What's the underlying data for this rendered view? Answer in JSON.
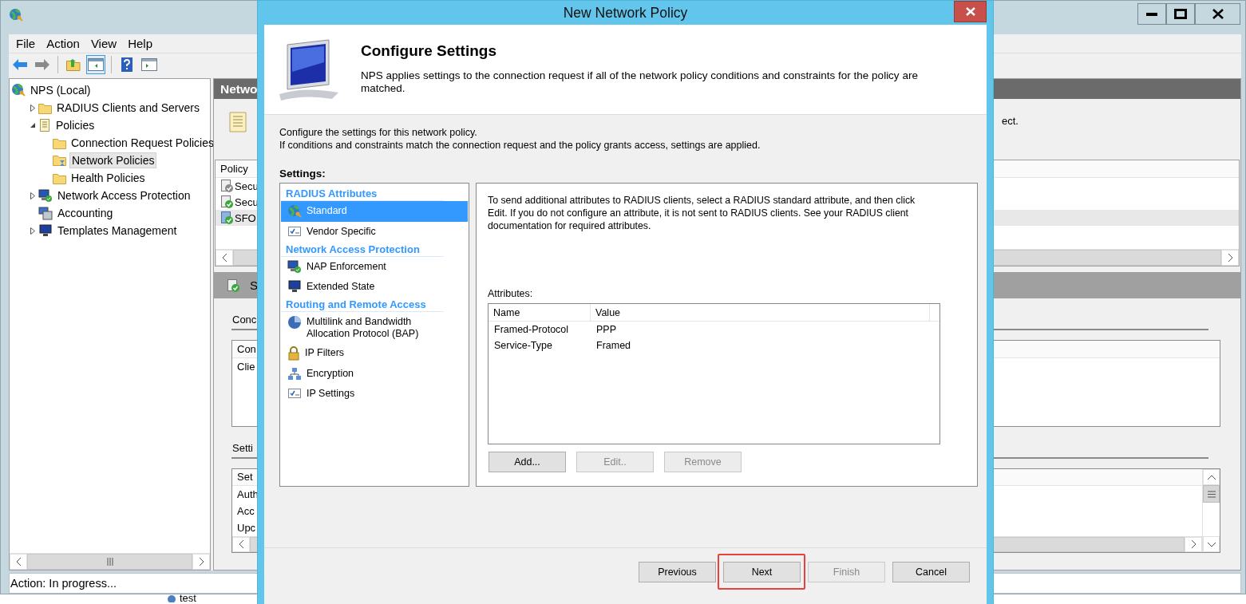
{
  "console": {
    "menu": [
      "File",
      "Action",
      "View",
      "Help"
    ],
    "toolbar": [
      {
        "disabled": false,
        "pressed": false
      },
      {
        "disabled": true,
        "pressed": false
      },
      {
        "disabled": false,
        "pressed": false
      },
      {
        "disabled": false,
        "pressed": true
      },
      {
        "disabled": false,
        "pressed": false
      },
      {
        "disabled": false,
        "pressed": false
      }
    ],
    "tree": [
      {
        "label": "NPS (Local)",
        "selected": false,
        "children": [
          {
            "label": "RADIUS Clients and Servers",
            "selected": false,
            "expanded": false
          },
          {
            "label": "Policies",
            "selected": false,
            "expanded": true,
            "children": [
              {
                "label": "Connection Request Policies",
                "selected": false
              },
              {
                "label": "Network Policies",
                "selected": true
              },
              {
                "label": "Health Policies",
                "selected": false
              }
            ]
          },
          {
            "label": "Network Access Protection",
            "selected": false,
            "expanded": false
          },
          {
            "label": "Accounting",
            "selected": false
          },
          {
            "label": "Templates Management",
            "selected": false,
            "expanded": false
          }
        ]
      }
    ],
    "details": {
      "title": "Netwo",
      "note": "ect.",
      "policies": {
        "column_1": "Policy",
        "rows": [
          {
            "name": "Secu",
            "selected": false
          },
          {
            "name": "Secu",
            "selected": false
          },
          {
            "name": "SFO",
            "selected": true
          }
        ]
      },
      "policy_bar": "S",
      "conditions": {
        "heading": "Conc",
        "column_1": "Con",
        "rows": [
          "Clie"
        ]
      },
      "settings": {
        "heading": "Setti",
        "column_1": "Set",
        "rows": [
          "Auth",
          "Acc",
          "Upc"
        ]
      }
    },
    "status_bar": "Action:  In progress..."
  },
  "desktop_item": "test",
  "dialog": {
    "title": "New Network Policy",
    "heading": "Configure Settings",
    "description": "NPS applies settings to the connection request if all of the network policy conditions and constraints for the policy are matched.",
    "intro": [
      "Configure the settings for this network policy.",
      "If conditions and constraints match the connection request and the policy grants access, settings are applied."
    ],
    "settings_label": "Settings:",
    "groups": [
      {
        "title": "RADIUS Attributes",
        "items": [
          {
            "label": "Standard",
            "selected": true
          },
          {
            "label": "Vendor Specific",
            "selected": false
          }
        ]
      },
      {
        "title": "Network Access Protection",
        "items": [
          {
            "label": "NAP Enforcement",
            "selected": false
          },
          {
            "label": "Extended State",
            "selected": false
          }
        ]
      },
      {
        "title": "Routing and Remote Access",
        "items": [
          {
            "label": "Multilink and Bandwidth Allocation Protocol (BAP)",
            "selected": false
          },
          {
            "label": "IP Filters",
            "selected": false
          },
          {
            "label": "Encryption",
            "selected": false
          },
          {
            "label": "IP Settings",
            "selected": false
          }
        ]
      }
    ],
    "panel_text": "To send additional attributes to RADIUS clients, select a RADIUS standard attribute, and then click Edit. If you do not configure an attribute, it is not sent to RADIUS clients. See your RADIUS client documentation for required attributes.",
    "attributes_label": "Attributes:",
    "attributes": {
      "columns": [
        "Name",
        "Value"
      ],
      "rows": [
        [
          "Framed-Protocol",
          "PPP"
        ],
        [
          "Service-Type",
          "Framed"
        ]
      ]
    },
    "attribute_buttons": [
      {
        "label": "Add...",
        "disabled": false
      },
      {
        "label": "Edit..",
        "disabled": true
      },
      {
        "label": "Remove",
        "disabled": true
      }
    ],
    "footer_buttons": [
      {
        "label": "Previous",
        "disabled": false,
        "highlighted": false
      },
      {
        "label": "Next",
        "disabled": false,
        "highlighted": true
      },
      {
        "label": "Finish",
        "disabled": true,
        "highlighted": false
      },
      {
        "label": "Cancel",
        "disabled": false,
        "highlighted": false
      }
    ]
  }
}
